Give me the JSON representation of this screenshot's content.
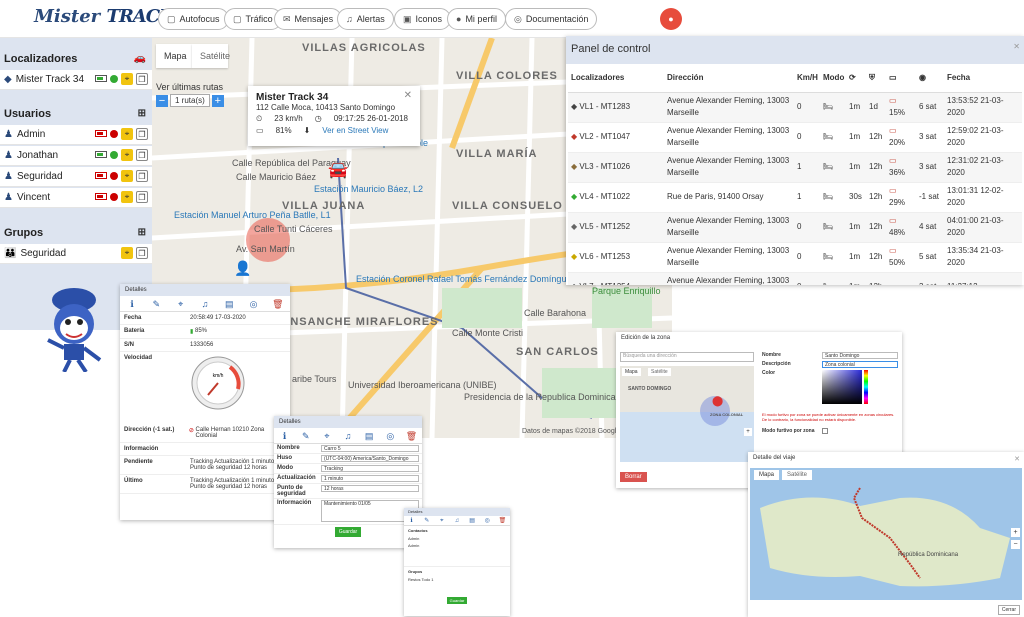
{
  "app": {
    "logo_text1": "Mister",
    "logo_text2": "TRACK"
  },
  "nav": [
    {
      "label": "Autofocus",
      "icon": "square-icon"
    },
    {
      "label": "Tráfico",
      "icon": "square-icon"
    },
    {
      "label": "Mensajes",
      "icon": "envelope-icon"
    },
    {
      "label": "Alertas",
      "icon": "bell-icon"
    },
    {
      "label": "Iconos",
      "icon": "image-icon"
    },
    {
      "label": "Mi perfil",
      "icon": "user-icon"
    },
    {
      "label": "Documentación",
      "icon": "book-icon"
    }
  ],
  "sidebar": {
    "localizadores_title": "Localizadores",
    "localizadores": [
      {
        "name": "Mister Track 34"
      }
    ],
    "usuarios_title": "Usuarios",
    "usuarios": [
      {
        "name": "Admin"
      },
      {
        "name": "Jonathan"
      },
      {
        "name": "Seguridad"
      },
      {
        "name": "Vincent"
      }
    ],
    "grupos_title": "Grupos",
    "grupos": [
      {
        "name": "Seguridad"
      }
    ]
  },
  "map": {
    "tab_map": "Mapa",
    "tab_sat": "Satélite",
    "routes_label": "Ver últimas rutas",
    "routes_value": "1 ruta(s)",
    "copyright": "Datos de mapas ©2018 Google",
    "labels": [
      "VILLAS AGRICOLAS",
      "VILLA COLORES",
      "VILLA MARÍA",
      "VILLA JUANA",
      "VILLA CONSUELO",
      "ENSANCHE MIRAFLORES",
      "SAN CARLOS",
      "Calle República del Paraguay",
      "Calle Mauricio Báez",
      "Calle Tunti Cáceres",
      "Parque Enriquillo",
      "Presidencia de la Republica Dominicana",
      "Universidad Iberoamericana (UNIBE)",
      "aribe Tours",
      "Estación Mauricio Báez, L2",
      "Estación Coronel Rafael Tomás Fernández Domínguez, L2",
      "Estación Manuel Arturo Peña Batlle, L1",
      "Aqua Potable",
      "Calle Barahona",
      "Calle Monte Cristi",
      "Av. San Martín"
    ],
    "info": {
      "title": "Mister Track 34",
      "address": "112 Calle Moca, 10413 Santo Domingo",
      "speed": "23 km/h",
      "time": "09:17:25 26-01-2018",
      "battery": "81%",
      "street_view": "Ver en Street View"
    }
  },
  "panel": {
    "title": "Panel de control",
    "columns": [
      "Localizadores",
      "Dirección",
      "Km/H",
      "Modo",
      "",
      "",
      "",
      "",
      "Fecha"
    ],
    "rows": [
      {
        "name": "VL1 - MT1283",
        "dir": "Avenue Alexander Fleming, 13003 Marseille",
        "kmh": "0",
        "t1": "1m",
        "t2": "1d",
        "pct": "15%",
        "sat": "6 sat",
        "date": "13:53:52 21-03-2020",
        "color": "#444"
      },
      {
        "name": "VL2 - MT1047",
        "dir": "Avenue Alexander Fleming, 13003 Marseille",
        "kmh": "0",
        "t1": "1m",
        "t2": "12h",
        "pct": "20%",
        "sat": "3 sat",
        "date": "12:59:02 21-03-2020",
        "color": "#c0392b"
      },
      {
        "name": "VL3 - MT1026",
        "dir": "Avenue Alexander Fleming, 13003 Marseille",
        "kmh": "1",
        "t1": "1m",
        "t2": "12h",
        "pct": "36%",
        "sat": "3 sat",
        "date": "12:31:02 21-03-2020",
        "color": "#8a6d3b"
      },
      {
        "name": "VL4 - MT1022",
        "dir": "Rue de Paris, 91400 Orsay",
        "kmh": "1",
        "t1": "30s",
        "t2": "12h",
        "pct": "29%",
        "sat": "-1 sat",
        "date": "13:01:31 12-02-2020",
        "color": "#3a3"
      },
      {
        "name": "VL5 - MT1252",
        "dir": "Avenue Alexander Fleming, 13003 Marseille",
        "kmh": "0",
        "t1": "1m",
        "t2": "12h",
        "pct": "48%",
        "sat": "4 sat",
        "date": "04:01:00 21-03-2020",
        "color": "#666"
      },
      {
        "name": "VL6 - MT1253",
        "dir": "Avenue Alexander Fleming, 13003 Marseille",
        "kmh": "0",
        "t1": "1m",
        "t2": "12h",
        "pct": "50%",
        "sat": "5 sat",
        "date": "13:35:34 21-03-2020",
        "color": "#c9a800"
      },
      {
        "name": "VL7 - MT1254",
        "dir": "Avenue Alexander Fleming, 13003 Marseille",
        "kmh": "0",
        "t1": "1m",
        "t2": "12h",
        "pct": "",
        "sat": "3 sat",
        "date": "11:27:12",
        "color": "#555"
      }
    ]
  },
  "details1": {
    "title": "Detalles",
    "fecha_k": "Fecha",
    "fecha_v": "20:58:49 17-03-2020",
    "bateria_k": "Batería",
    "bateria_v": "85%",
    "sn_k": "S/N",
    "sn_v": "1333056",
    "velocidad_k": "Velocidad",
    "gauge_unit": "km/h",
    "direccion_k": "Dirección (-1 sat.)",
    "direccion_v": "Calle Hernan 10210 Zona Colonial",
    "info_k": "Información",
    "pend_k": "Pendiente",
    "pend_v": "Tracking Actualización 1 minutos Punto de seguridad 12 horas",
    "ult_k": "Último",
    "ult_v": "Tracking Actualización 1 minutos Punto de seguridad 12 horas"
  },
  "details2": {
    "title": "Detalles",
    "nombre_k": "Nombre",
    "nombre_v": "Carro 5",
    "huso_k": "Huso",
    "huso_v": "(UTC-04:00) America/Santo_Domingo",
    "modo_k": "Modo",
    "modo_v": "Tracking",
    "act_k": "Actualización",
    "act_v": "1 minuto",
    "punto_k": "Punto de seguridad",
    "punto_v": "12 horas",
    "info_k": "Información",
    "info_v": "Mantenimiento 01/05",
    "save": "Guardar"
  },
  "details3": {
    "title": "Detalles",
    "contacts": "Contactos",
    "groups": "Grupos",
    "c1": "Admin",
    "c2": "Admin",
    "g1": "Restos Todo 1",
    "save": "Guardar"
  },
  "zone": {
    "title": "Edición de la zona",
    "search_ph": "Búsqueda una dirección",
    "tab_map": "Mapa",
    "tab_sat": "Satélite",
    "label_santo": "SANTO DOMINGO",
    "label_zona": "ZONA COLONIAL",
    "nombre_k": "Nombre",
    "nombre_v": "Santo Domingo",
    "desc_k": "Descripción",
    "desc_v": "Zona colonial",
    "color_k": "Color",
    "warn": "El modo furtivo por zona se puede activar únicamente en zonas circulares. De lo contrario, la funcionalidad no estará disponible.",
    "furtivo_k": "Modo furtivo por zona",
    "delete": "Borrar"
  },
  "trip": {
    "title": "Detalle del viaje",
    "tab_map": "Mapa",
    "tab_sat": "Satélite",
    "label": "República Dominicana",
    "close": "Cerrar"
  }
}
